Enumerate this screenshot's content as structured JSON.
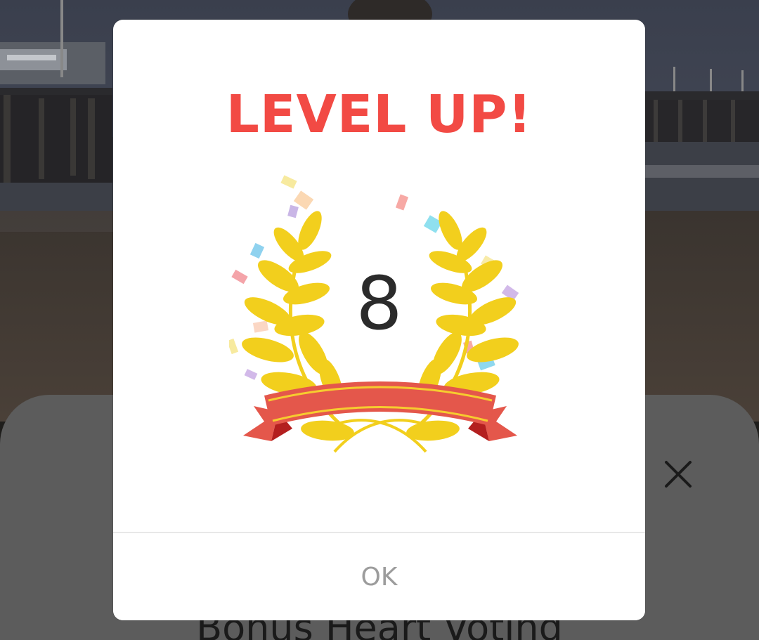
{
  "dialog": {
    "heading": "LEVEL UP!",
    "level": "8",
    "ok_label": "OK",
    "heading_color": "#f24a44",
    "laurel_color": "#f2cf1d",
    "ribbon_color": "#e4574b"
  },
  "bottom_sheet": {
    "title": "Bonus Heart Voting",
    "close_icon": "close-icon"
  }
}
